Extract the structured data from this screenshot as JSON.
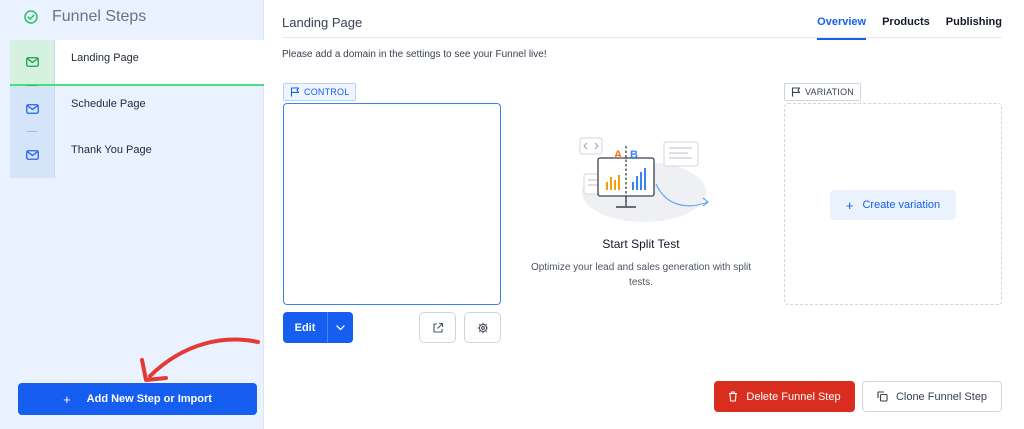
{
  "sidebar": {
    "title": "Funnel Steps",
    "title_icon": "check-circle-icon",
    "steps": [
      {
        "label": "Landing Page",
        "icon": "mail-icon",
        "active": true
      },
      {
        "label": "Schedule Page",
        "icon": "mail-icon",
        "active": false
      },
      {
        "label": "Thank You Page",
        "icon": "mail-icon",
        "active": false
      }
    ],
    "add_button": {
      "icon": "+",
      "label": "Add New Step or Import"
    }
  },
  "main": {
    "page_title": "Landing Page",
    "tabs": [
      {
        "label": "Overview",
        "active": true
      },
      {
        "label": "Products",
        "active": false
      },
      {
        "label": "Publishing",
        "active": false
      }
    ],
    "notice": "Please add a domain in the settings to see your Funnel live!",
    "control": {
      "badge": "CONTROL",
      "edit_label": "Edit"
    },
    "split_test": {
      "illustration_label_a": "A",
      "illustration_label_b": "B",
      "title": "Start Split Test",
      "description": "Optimize your lead and sales generation with split tests."
    },
    "variation": {
      "badge": "VARIATION",
      "create_icon": "+",
      "create_label": "Create variation"
    },
    "footer": {
      "delete_label": "Delete Funnel Step",
      "clone_label": "Clone Funnel Step"
    }
  },
  "colors": {
    "primary": "#155eef",
    "danger": "#d92d20",
    "active_step": "#22c55e",
    "sidebar_bg": "#e9f2fe",
    "annotation_arrow": "#e53935"
  }
}
